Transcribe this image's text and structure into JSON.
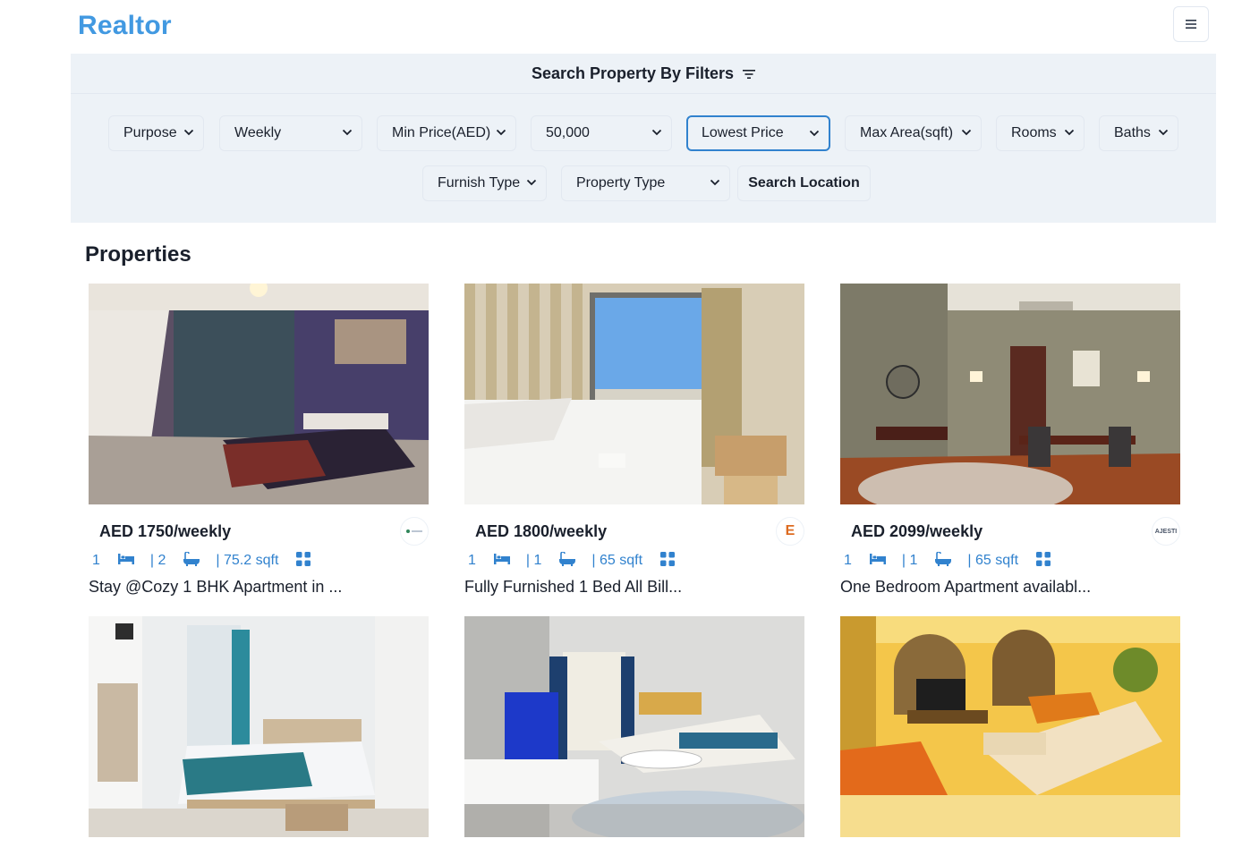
{
  "app": {
    "logo": "Realtor"
  },
  "icons": {
    "menu": "hamburger-icon",
    "filter": "filter-lines-icon",
    "bed": "bed-icon",
    "bath": "bathtub-icon",
    "area": "grid-icon",
    "chevron": "chevron-down-icon"
  },
  "colors": {
    "brand": "#4299e1",
    "accent": "#3182ce",
    "panel": "#edf2f7"
  },
  "filters": {
    "title": "Search Property By Filters",
    "purpose": "Purpose",
    "rent_frequency": "Weekly",
    "min_price": "Min Price(AED)",
    "max_price": "50,000",
    "sort": "Lowest Price",
    "max_area": "Max Area(sqft)",
    "rooms": "Rooms",
    "baths": "Baths",
    "furnish_type": "Furnish Type",
    "property_type": "Property Type",
    "search_location": "Search Location"
  },
  "section": {
    "title": "Properties"
  },
  "properties": [
    {
      "price": "AED 1750/weekly",
      "rooms": "1",
      "baths": "| 2",
      "area": "| 75.2 sqft",
      "title": "Stay @Cozy 1 BHK Apartment in ...",
      "agency_logo": ""
    },
    {
      "price": "AED 1800/weekly",
      "rooms": "1",
      "baths": "| 1",
      "area": "| 65 sqft",
      "title": "Fully Furnished 1 Bed All Bill...",
      "agency_logo": "E"
    },
    {
      "price": "AED 2099/weekly",
      "rooms": "1",
      "baths": "| 1",
      "area": "| 65 sqft",
      "title": "One Bedroom Apartment availabl...",
      "agency_logo": "AJESTI"
    },
    {
      "price": "",
      "rooms": "",
      "baths": "",
      "area": "",
      "title": "",
      "agency_logo": ""
    },
    {
      "price": "",
      "rooms": "",
      "baths": "",
      "area": "",
      "title": "",
      "agency_logo": ""
    },
    {
      "price": "",
      "rooms": "",
      "baths": "",
      "area": "",
      "title": "",
      "agency_logo": ""
    }
  ]
}
